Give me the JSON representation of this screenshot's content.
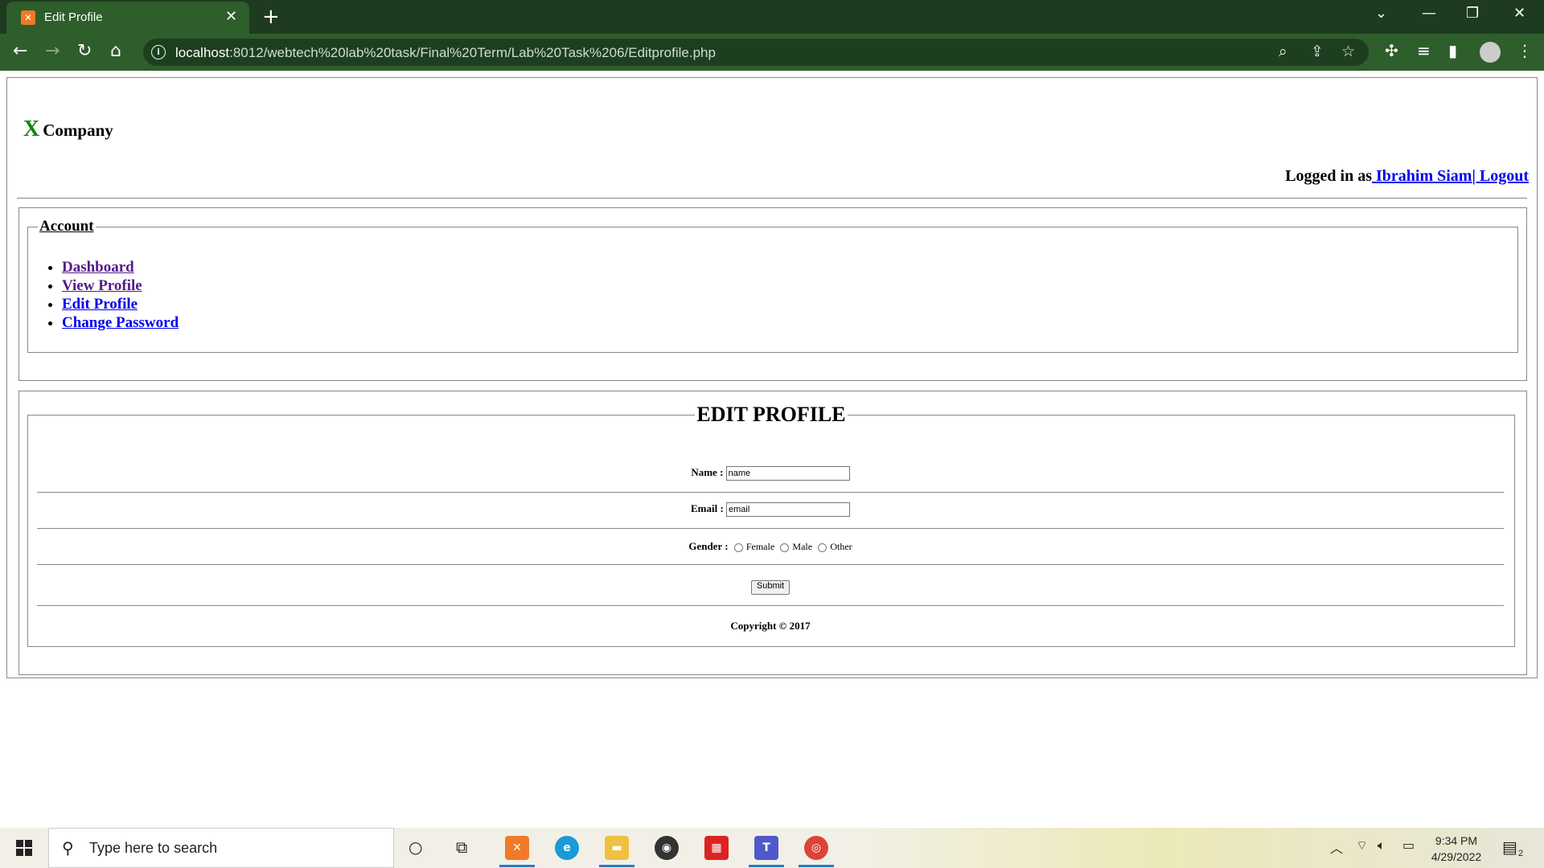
{
  "browser": {
    "tab_title": "Edit Profile",
    "tab_favicon": "xampp-icon",
    "url_host": "localhost",
    "url_rest": ":8012/webtech%20lab%20task/Final%20Term/Lab%20Task%206/Editprofile.php"
  },
  "header": {
    "logo_letter": "X",
    "logo_name": "Company",
    "logged_in_prefix": "Logged in as",
    "user_name": " Ibrahim Siam",
    "logout_label": "| Logout"
  },
  "account": {
    "legend": "Account",
    "links": [
      {
        "label": "Dashboard"
      },
      {
        "label": "View Profile"
      },
      {
        "label": "Edit Profile"
      },
      {
        "label": "Change Password"
      }
    ]
  },
  "form": {
    "title": "EDIT PROFILE",
    "name_label": "Name :",
    "name_value": "name",
    "email_label": "Email :",
    "email_value": "email",
    "gender_label": "Gender :",
    "gender_options": [
      "Female",
      "Male",
      "Other"
    ],
    "submit_label": "Submit",
    "copyright": "Copyright © 2017"
  },
  "taskbar": {
    "search_placeholder": "Type here to search",
    "time": "9:34 PM",
    "date": "4/29/2022",
    "notification_count": "2"
  }
}
